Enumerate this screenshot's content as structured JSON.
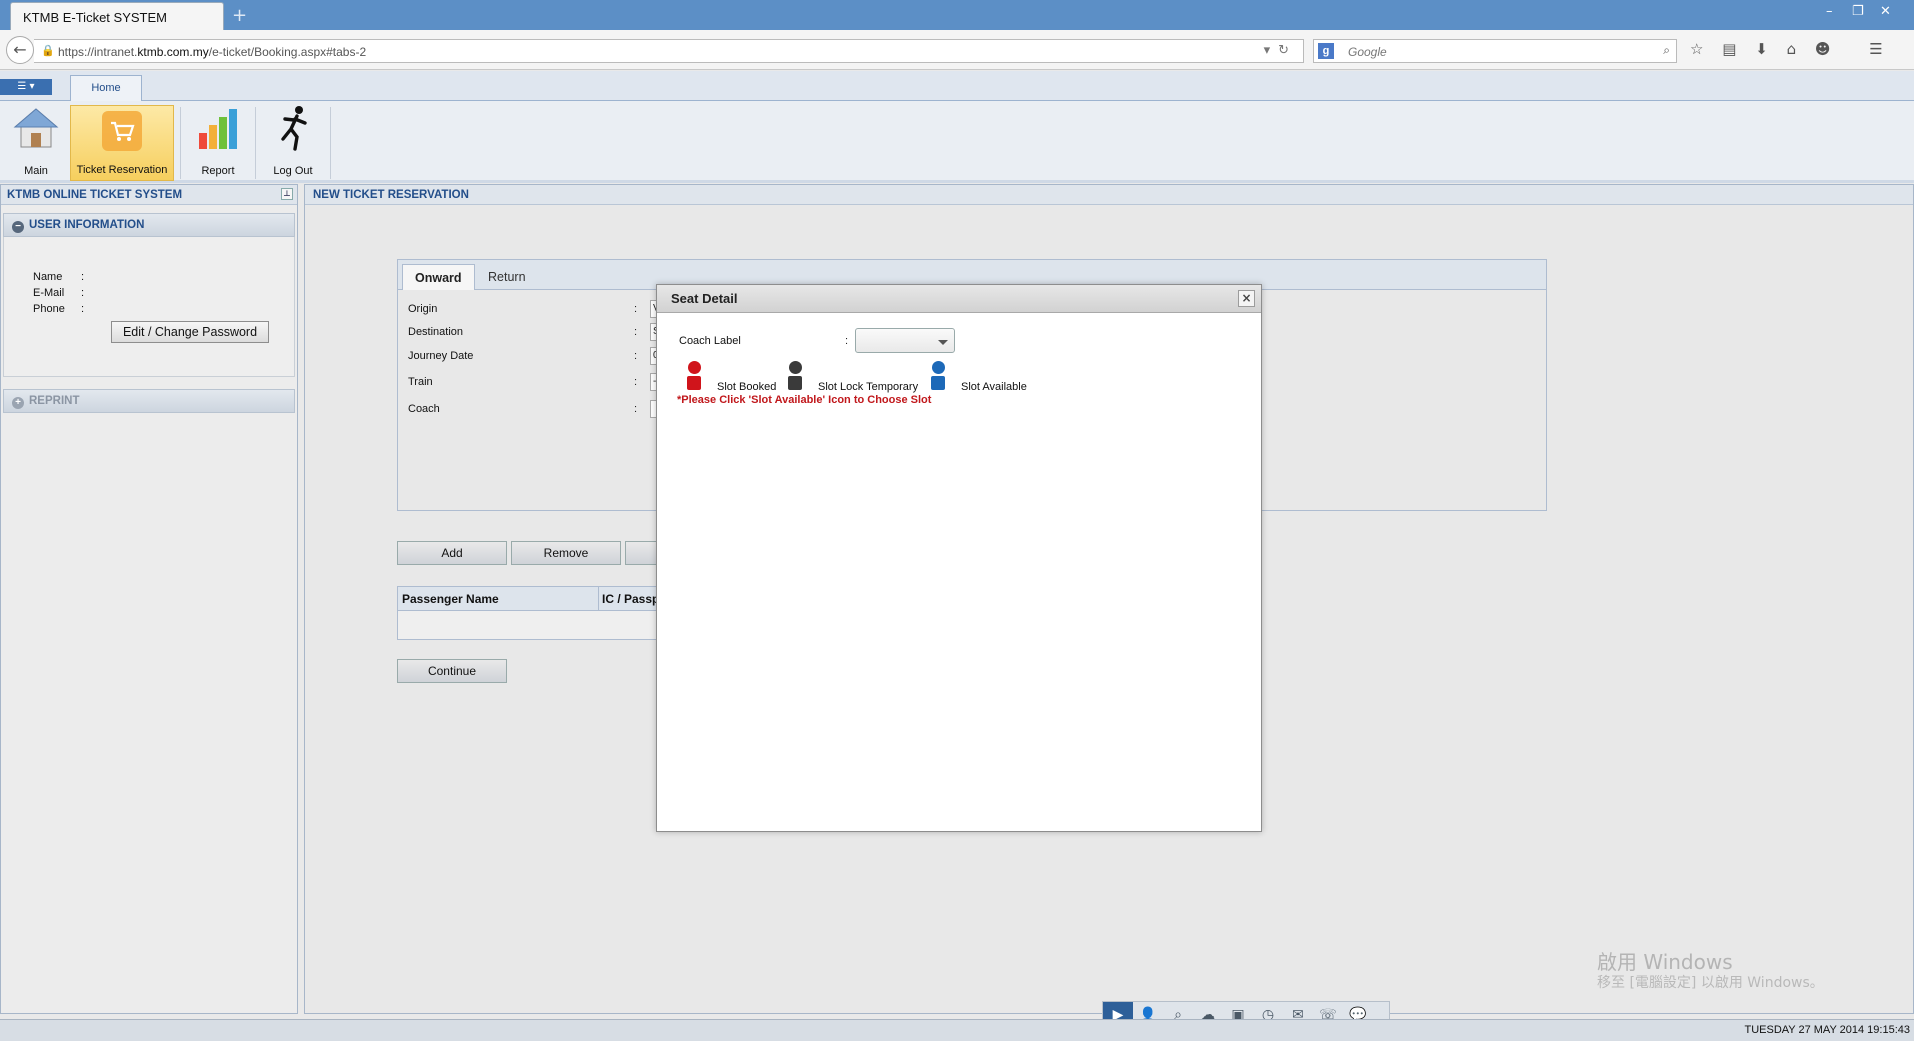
{
  "browser": {
    "tab_title": "KTMB E-Ticket SYSTEM",
    "new_tab": "+",
    "url_prefix": "https://intranet.",
    "url_domain": "ktmb.com.my",
    "url_path": "/e-ticket/Booking.aspx#tabs-2",
    "search_engine_glyph": "g",
    "search_placeholder": "Google"
  },
  "ribbon": {
    "menu_glyph": "☰ ▾",
    "home_tab": "Home",
    "buttons": [
      {
        "label": "Main",
        "icon": "house-icon"
      },
      {
        "label": "Ticket Reservation",
        "icon": "cart-icon"
      },
      {
        "label": "Report",
        "icon": "bar-chart-icon"
      },
      {
        "label": "Log Out",
        "icon": "running-man-icon"
      }
    ]
  },
  "left_panel": {
    "title": "KTMB ONLINE TICKET SYSTEM",
    "user_info_title": "USER INFORMATION",
    "fields": {
      "name": "Name",
      "email": "E-Mail",
      "phone": "Phone",
      "colon": ":"
    },
    "edit_button": "Edit / Change Password",
    "reprint_title": "REPRINT"
  },
  "main_panel": {
    "title": "NEW TICKET RESERVATION",
    "tabs": {
      "onward": "Onward",
      "return": "Return"
    },
    "labels": {
      "origin": "Origin",
      "destination": "Destination",
      "journey_date": "Journey Date",
      "train": "Train",
      "coach": "Coach",
      "colon": ":"
    },
    "partial_values": {
      "origin": "V",
      "destination": "S",
      "journey_date": "0",
      "train": "-",
      "coach": ""
    },
    "buttons": {
      "add": "Add",
      "remove": "Remove",
      "continue": "Continue"
    },
    "grid_headers": {
      "passenger_name": "Passenger Name",
      "ic_passport": "IC / Passp"
    }
  },
  "modal": {
    "title": "Seat Detail",
    "close": "×",
    "coach_label": "Coach Label",
    "colon": ":",
    "legend": {
      "booked": "Slot Booked",
      "locked": "Slot Lock Temporary",
      "available": "Slot Available"
    },
    "notice": "*Please Click 'Slot Available' Icon to Choose Slot",
    "colors": {
      "booked": "#d0141b",
      "locked": "#3a3a3a",
      "available": "#1d69b8"
    }
  },
  "watermark": {
    "line1": "啟用 Windows",
    "line2": "移至 [電腦設定] 以啟用 Windows。"
  },
  "status": {
    "datetime": "TUESDAY 27 MAY 2014 19:15:43"
  }
}
